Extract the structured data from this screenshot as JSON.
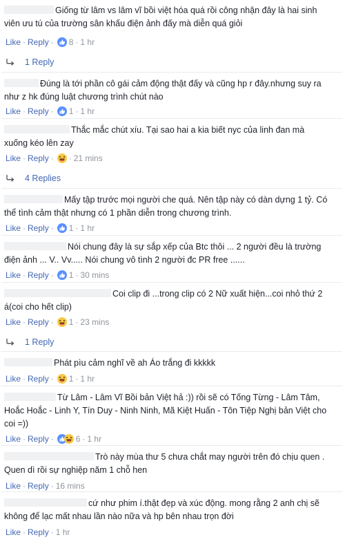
{
  "ui": {
    "like": "Like",
    "reply": "Reply",
    "sep": "·"
  },
  "comments": [
    {
      "text": "Giống từ lâm vs lâm vĩ bồi việt hóa quá rồi công nhận đây là hai sinh viên ưu tú của trường sân khấu điện ảnh đấy mà diễn quá giỏi",
      "reaction": "like-icon",
      "count": "8",
      "time": "1 hr",
      "replies": "1 Reply"
    },
    {
      "text": "Đúng là tới phần cô gái cảm động thật đấy và cũng hp r đây.nhưng suy ra như z hk đúng luật chương trình chút nào",
      "reaction": "like-icon",
      "count": "1",
      "time": "1 hr"
    },
    {
      "text": "Thắc mắc chút xíu. Tại sao hai a kia biết nyc của linh đan mà xuống kéo lên zay",
      "reaction": "haha-icon",
      "count": "",
      "time": "21 mins",
      "replies": "4 Replies"
    },
    {
      "text": "Mấy tập trước mọi người che quá. Nên tập này có dàn dựng 1 tỷ. Có thể tình cảm thật nhưng có 1 phần diễn trong chương trình.",
      "reaction": "like-icon",
      "count": "1",
      "time": "1 hr"
    },
    {
      "text": "Nói chung đây là sự sắp xếp của Btc thôi ... 2 người đều là trường điện ảnh ... V.. Vv..... Nói chung vô tình 2 người đc PR free ......",
      "reaction": "like-icon",
      "count": "1",
      "time": "30 mins"
    },
    {
      "text": "Coi clip đi ...trong clip có 2 Nữ xuất hiện...coi nhỏ thứ 2 á(coi cho hết clip)",
      "reaction": "haha-icon",
      "count": "1",
      "time": "23 mins",
      "replies": "1 Reply"
    },
    {
      "text": "Phát pìu cảm nghĩ về ah Áo trắng đi kkkkk",
      "reaction": "haha-icon",
      "count": "1",
      "time": "1 hr"
    },
    {
      "text": "Từ Lâm - Lâm Vĩ Bồi bản Việt hả :)) rồi sẽ có Tống Từng - Lâm Tâm, Hoắc Hoắc - Linh Y, Tín Duy - Ninh Ninh, Mã Kiệt Huấn - Tôn Tiệp Nghị bản Việt cho coi =))",
      "reaction": "like-haha-icons",
      "count": "6",
      "time": "1 hr"
    },
    {
      "text": "Trò này mùa thư 5 chưa chắt may người trên đó chịu quen . Quen dì rồi sự nghiệp năm 1 chỗ hen",
      "reaction": "",
      "count": "",
      "time": "16 mins"
    },
    {
      "text": "cứ như phim í.thật đẹp và xúc động. mong rằng 2 anh chị sẽ không để lạc mất nhau lần nào nữa và hp bên nhau trọn đời",
      "reaction": "",
      "count": "",
      "time": "1 hr"
    }
  ]
}
